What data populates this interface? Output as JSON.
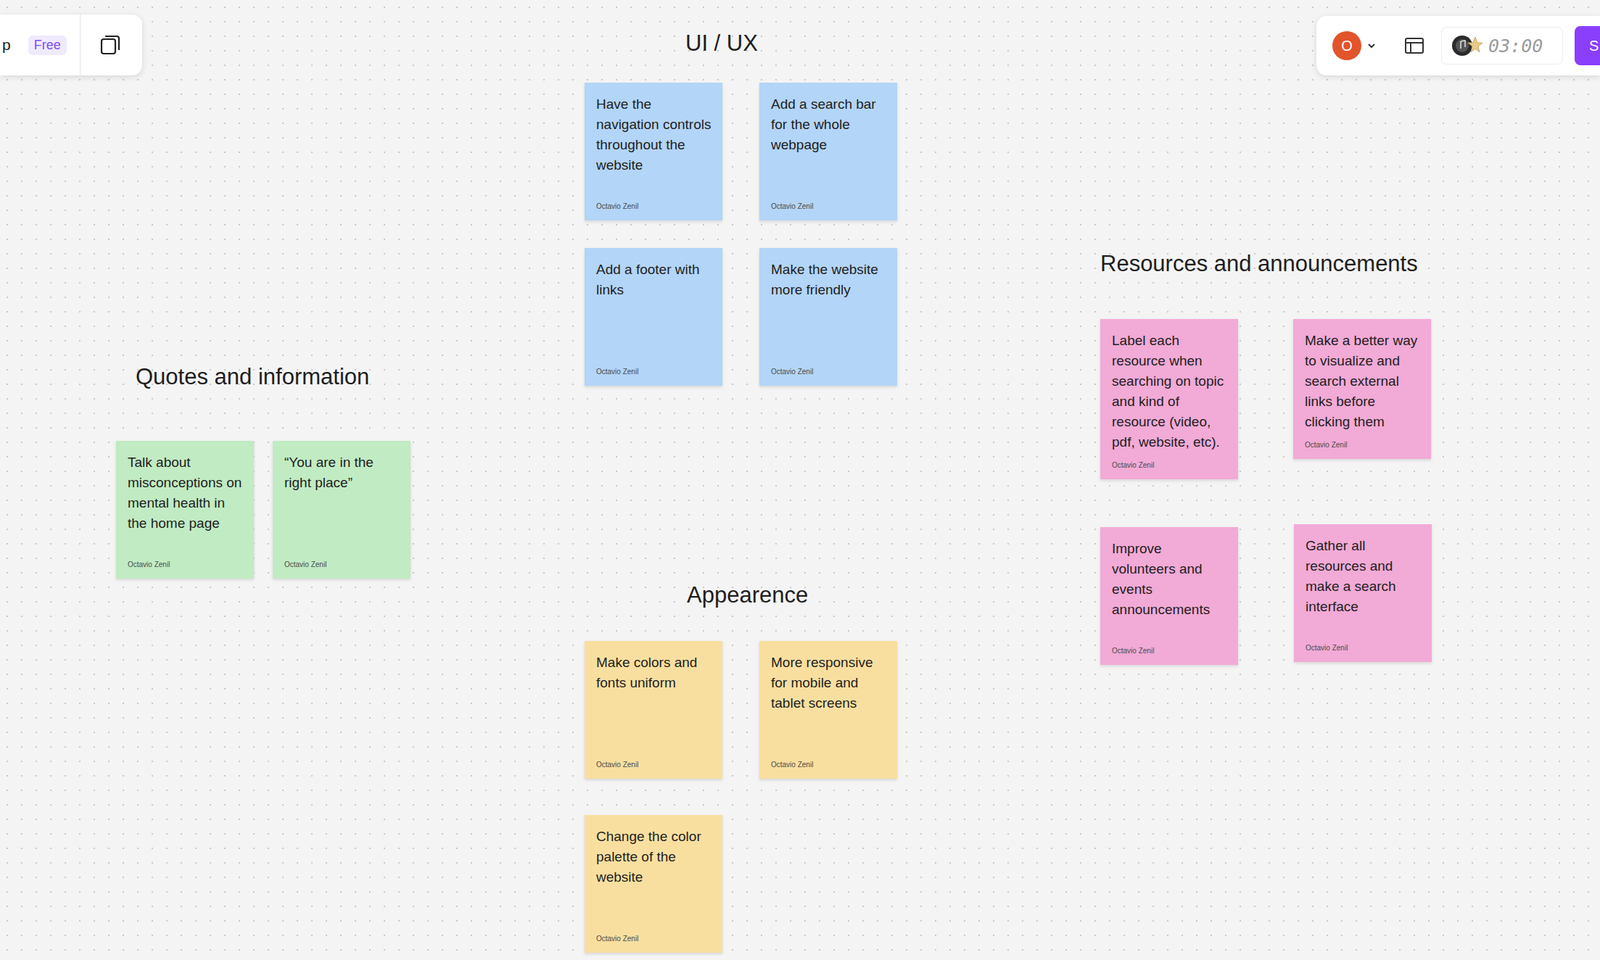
{
  "toolbar_left": {
    "app_name": "p",
    "plan_badge": "Free"
  },
  "toolbar_right": {
    "avatar": "O",
    "timer": "03:00",
    "button": "S"
  },
  "sections": [
    {
      "title": "UI / UX",
      "color": "#b3d5f7",
      "notes": [
        {
          "text": "Have the navigation controls throughout the website",
          "author": "Octavio Zenil"
        },
        {
          "text": "Add a search bar for the whole webpage",
          "author": "Octavio Zenil"
        },
        {
          "text": "Add a footer with links",
          "author": "Octavio Zenil"
        },
        {
          "text": "Make the website more friendly",
          "author": "Octavio Zenil"
        }
      ]
    },
    {
      "title": "Quotes and information",
      "color": "#c1ebc3",
      "notes": [
        {
          "text": "Talk about misconceptions on mental health in the home page",
          "author": "Octavio Zenil"
        },
        {
          "text": "“You are in the right place”",
          "author": "Octavio Zenil"
        }
      ]
    },
    {
      "title": "Resources and announcements",
      "color": "#f2aad6",
      "notes": [
        {
          "text": "Label each resource when searching on topic and kind of resource (video, pdf, website, etc).",
          "author": "Octavio Zenil"
        },
        {
          "text": "Make a better way to visualize and search external links before clicking them",
          "author": "Octavio Zenil"
        },
        {
          "text": "Improve volunteers and events announcements",
          "author": "Octavio Zenil"
        },
        {
          "text": "Gather all resources and make a search interface",
          "author": "Octavio Zenil"
        }
      ]
    },
    {
      "title": "Appearence",
      "color": "#f8dfa0",
      "notes": [
        {
          "text": "Make colors and fonts uniform",
          "author": "Octavio Zenil"
        },
        {
          "text": "More responsive for mobile and tablet screens",
          "author": "Octavio Zenil"
        },
        {
          "text": "Change the color palette of the website",
          "author": "Octavio Zenil"
        }
      ]
    }
  ]
}
